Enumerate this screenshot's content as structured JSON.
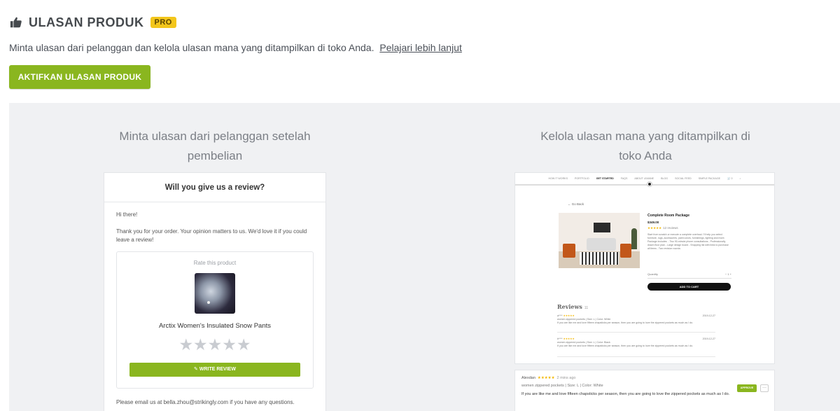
{
  "header": {
    "icon": "thumbs-up-icon",
    "title": "ULASAN PRODUK",
    "badge": "PRO"
  },
  "description": {
    "text": "Minta ulasan dari pelanggan dan kelola ulasan mana yang ditampilkan di toko Anda.",
    "link_label": "Pelajari lebih lanjut"
  },
  "cta": {
    "label": "AKTIFKAN ULASAN PRODUK"
  },
  "left_column": {
    "title": "Minta ulasan dari pelanggan setelah pembelian",
    "email": {
      "heading": "Will you give us a review?",
      "greeting": "Hi there!",
      "message": "Thank you for your order. Your opinion matters to us. We'd love it if you could leave a review!",
      "rate_label": "Rate this product",
      "product_name": "Arctix Women's Insulated Snow Pants",
      "stars": "★★★★★",
      "write_review_label": "✎  WRITE REVIEW",
      "footer": "Please email us at bella.zhou@strikingly.com if you have any questions."
    }
  },
  "right_column": {
    "title": "Kelola ulasan mana yang ditampilkan di toko Anda",
    "store": {
      "nav": [
        "HOW IT WORKS",
        "PORTFOLIO",
        "GET STARTED",
        "FAQS",
        "ABOUT LEANNE",
        "BLOG",
        "SOCIAL FEED",
        "SIMPLE PACKAGE",
        "🛒 0",
        "⌕"
      ],
      "nav_active": 2,
      "go_back": "← Go Back",
      "product_title": "Complete Room Package",
      "price": "$349.00",
      "stars": "★★★★★",
      "reviews_count_small": "12 reviews",
      "product_desc": "Start from scratch or execute a complete overhaul. I'll help you select furniture, rugs, accessories, paint colors, furnishings, lighting and more. Package includes: - Two 90-minute phone consultations - Professionally drawn floor plan - Large design board - Shopping list with links to purchase all items - Two revision rounds",
      "quantity_label": "Quantity",
      "quantity_value": "−   1   +",
      "add_to_cart": "ADD TO CART",
      "reviews_heading": "Reviews",
      "reviews_count": "11",
      "reviews": [
        {
          "user": "a****",
          "stars": "★★★★★",
          "meta": "women zippered pockets  |  Size: L  |  Color: White",
          "text": "If you are like me and love fifteen chapsticks per season, then you are going to love the zippered pockets as much as I do.",
          "date": "2019-12-27"
        },
        {
          "user": "b****",
          "stars": "★★★★★",
          "meta": "women zippered pockets  |  Size: L  |  Color: Black",
          "text": "If you are like me and love fifteen chapsticks per season, then you are going to love the zippered pockets as much as I do.",
          "date": "2019-12-27"
        }
      ]
    },
    "admin": {
      "name": "Alexdan",
      "stars": "★★★★★",
      "ago": "2 mins ago",
      "meta": "women zippered pockets  |  Size: L  |  Color: White",
      "text": "If you are like me and love fifteen chapsticks per season, then you are going to love the zippered pockets as much as I do.",
      "approve_label": "APPROVE",
      "more_label": "···"
    }
  },
  "colors": {
    "accent": "#8ab61f",
    "badge": "#f3c61b",
    "panel_bg": "#f0f1f3"
  }
}
